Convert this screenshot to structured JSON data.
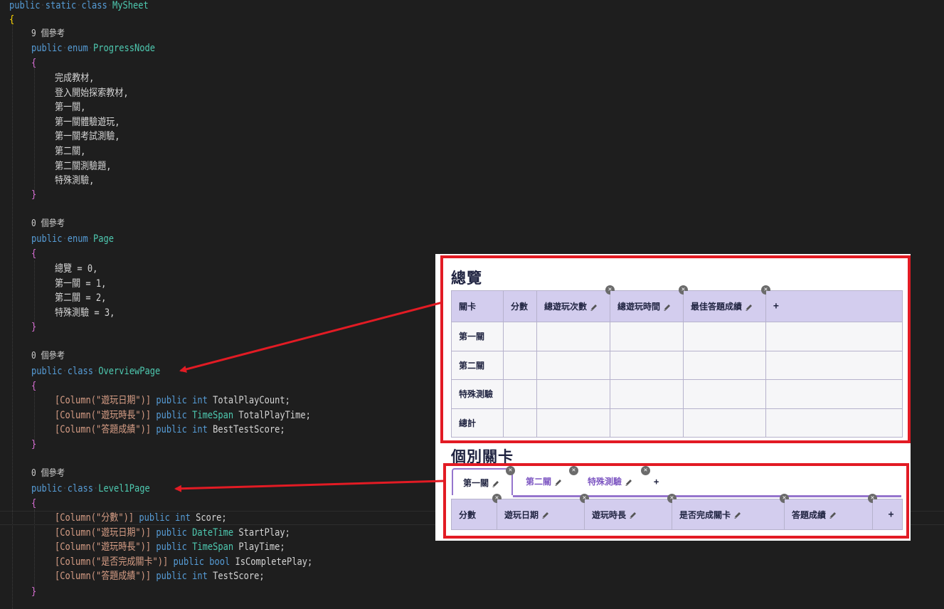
{
  "code": {
    "class_decl": [
      "public",
      "static",
      "class",
      "MySheet"
    ],
    "open_brace": "{",
    "close_brace": "}",
    "ref_progress": "9 個參考",
    "enum_progress": [
      "public",
      "enum",
      "ProgressNode"
    ],
    "progress_items": [
      "完成教材,",
      "登入開始探索教材,",
      "第一關,",
      "第一關體驗遊玩,",
      "第一關考試測驗,",
      "第二關,",
      "第二關測驗題,",
      "特殊測驗,"
    ],
    "ref_page": "0 個參考",
    "enum_page": [
      "public",
      "enum",
      "Page"
    ],
    "page_items": [
      "總覽 = 0,",
      "第一關 = 1,",
      "第二關 = 2,",
      "特殊測驗 = 3,"
    ],
    "ref_overview": "0 個參考",
    "class_overview": [
      "public",
      "class",
      "OverviewPage"
    ],
    "overview_fields": [
      {
        "attr": "[Column(\"遊玩日期\")]",
        "kw": "public",
        "type": "int",
        "name": "TotalPlayCount;"
      },
      {
        "attr": "[Column(\"遊玩時長\")]",
        "kw": "public",
        "type": "TimeSpan",
        "name": "TotalPlayTime;"
      },
      {
        "attr": "[Column(\"答題成績\")]",
        "kw": "public",
        "type": "int",
        "name": "BestTestScore;"
      }
    ],
    "ref_level": "0 個參考",
    "class_level": [
      "public",
      "class",
      "Level1Page"
    ],
    "level_fields": [
      {
        "attr": "[Column(\"分數\")]",
        "kw": "public",
        "type": "int",
        "name": "Score;"
      },
      {
        "attr": "[Column(\"遊玩日期\")]",
        "kw": "public",
        "type": "DateTime",
        "name": "StartPlay;"
      },
      {
        "attr": "[Column(\"遊玩時長\")]",
        "kw": "public",
        "type": "TimeSpan",
        "name": "PlayTime;"
      },
      {
        "attr": "[Column(\"是否完成關卡\")]",
        "kw": "public",
        "type": "bool",
        "name": "IsCompletePlay;"
      },
      {
        "attr": "[Column(\"答題成績\")]",
        "kw": "public",
        "type": "int",
        "name": "TestScore;"
      }
    ]
  },
  "overview": {
    "title": "總覽",
    "headers": [
      "關卡",
      "分數",
      "總遊玩次數",
      "總遊玩時間",
      "最佳答題成績",
      "+"
    ],
    "rows": [
      "第一關",
      "第二關",
      "特殊測驗",
      "總計"
    ]
  },
  "levels": {
    "title": "個別關卡",
    "tabs": [
      "第一關",
      "第二關",
      "特殊測驗"
    ],
    "add_tab": "+",
    "headers": [
      "分數",
      "遊玩日期",
      "遊玩時長",
      "是否完成關卡",
      "答題成績",
      "+"
    ]
  },
  "icons": {
    "edit": "pencil-icon",
    "remove": "close-circle-icon",
    "add": "plus-icon"
  },
  "colors": {
    "annotation": "#e21b24",
    "header_bg": "#d3cdee",
    "tab_accent": "#9575cd",
    "editor_bg": "#1e1e1e"
  }
}
